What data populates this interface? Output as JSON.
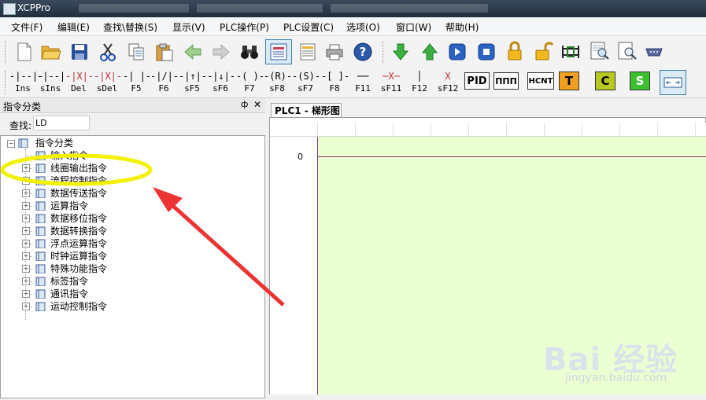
{
  "window": {
    "title": "XCPPro"
  },
  "menu": [
    "文件(F)",
    "编辑(E)",
    "查找\\替换(S)",
    "显示(V)",
    "PLC操作(P)",
    "PLC设置(C)",
    "选项(O)",
    "窗口(W)",
    "帮助(H)"
  ],
  "toolbar2": {
    "ladder_buttons": [
      "Ins",
      "sIns",
      "Del",
      "sDel",
      "F5",
      "F6",
      "sF5",
      "sF6",
      "F7",
      "sF8",
      "sF7",
      "F8",
      "F11",
      "sF11",
      "F12",
      "sF12"
    ],
    "ladder_symbols": [
      "-|--|-",
      "-|--|-",
      "-|X|-",
      "-|X|-",
      "-| |-",
      "-|/|-",
      "-|↑|-",
      "-|↓|-",
      "-( )-",
      "-(R)-",
      "-(S)-",
      "-[ ]-",
      "──",
      "─X─",
      "│",
      "X"
    ],
    "blocks": [
      "PID",
      "ΠΠΠ",
      "HCNT",
      "T",
      "C",
      "S"
    ]
  },
  "left_panel": {
    "title": "指令分类",
    "pin": "ф",
    "close": "✕",
    "search_label": "查找:",
    "search_value": "LD",
    "tree": {
      "root": "指令分类",
      "items": [
        "输入指令",
        "线圈输出指令",
        "流程控制指令",
        "数据传送指令",
        "运算指令",
        "数据移位指令",
        "数据转换指令",
        "浮点运算指令",
        "时钟运算指令",
        "特殊功能指令",
        "标签指令",
        "通讯指令",
        "运动控制指令"
      ]
    }
  },
  "editor": {
    "tab_label": "PLC1 - 梯形图",
    "row_number": "0",
    "background_color": "#eaffd2"
  },
  "annotation": {
    "highlight_color": "#f2f200",
    "arrow_color": "#ee3333"
  },
  "watermark": {
    "brand": "Bai  经验",
    "url": "jingyan.baidu.com"
  }
}
